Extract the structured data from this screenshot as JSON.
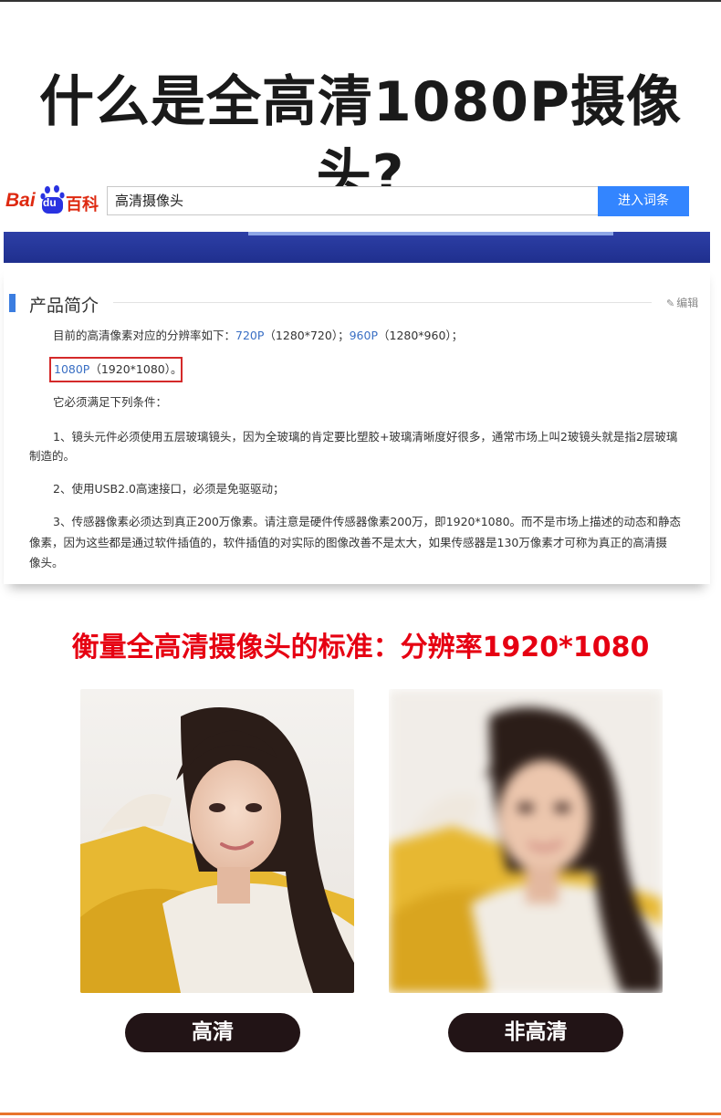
{
  "main_title": "什么是全高清1080P摄像头?",
  "baidu": {
    "logo_bai": "Bai",
    "logo_du": "du",
    "logo_baike": "百科",
    "search_value": "高清摄像头",
    "search_button": "进入词条"
  },
  "section": {
    "title": "产品简介",
    "edit_label": "编辑",
    "line1_prefix": "目前的高清像素对应的分辨率如下：",
    "line1_link1": "720P",
    "line1_mid": "（1280*720）；",
    "line1_link2": "960P",
    "line1_suffix": "（1280*960）；",
    "line2_link": "1080P",
    "line2_suffix": "（1920*1080）。",
    "line3": "它必须满足下列条件：",
    "item1_a": "1、镜头元件必须使用五层玻璃镜头，因为全玻璃的肯定要比塑胶+玻璃清晰度好很多，通常市场上叫2玻镜头就是指2层玻璃",
    "item1_b": "制造的。",
    "item2": "2、使用USB2.0高速接口，必须是免驱驱动；",
    "item3_a": "3、传感器像素必须达到真正200万像素。请注意是硬件传感器像素200万，即1920*1080。而不是市场上描述的动态和静态",
    "item3_b": "像素，因为这些都是通过软件插值的，软件插值的对实际的图像改善不是太大，如果传感器是130万像素才可称为真正的高清摄",
    "item3_c": "像头。"
  },
  "subtitle": "衡量全高清摄像头的标准：分辨率1920*1080",
  "labels": {
    "hd": "高清",
    "non_hd": "非高清"
  },
  "colors": {
    "accent_red": "#e60012",
    "baidu_blue": "#3385ff",
    "pill_bg": "#221416",
    "bottom_line": "#e8742b"
  }
}
